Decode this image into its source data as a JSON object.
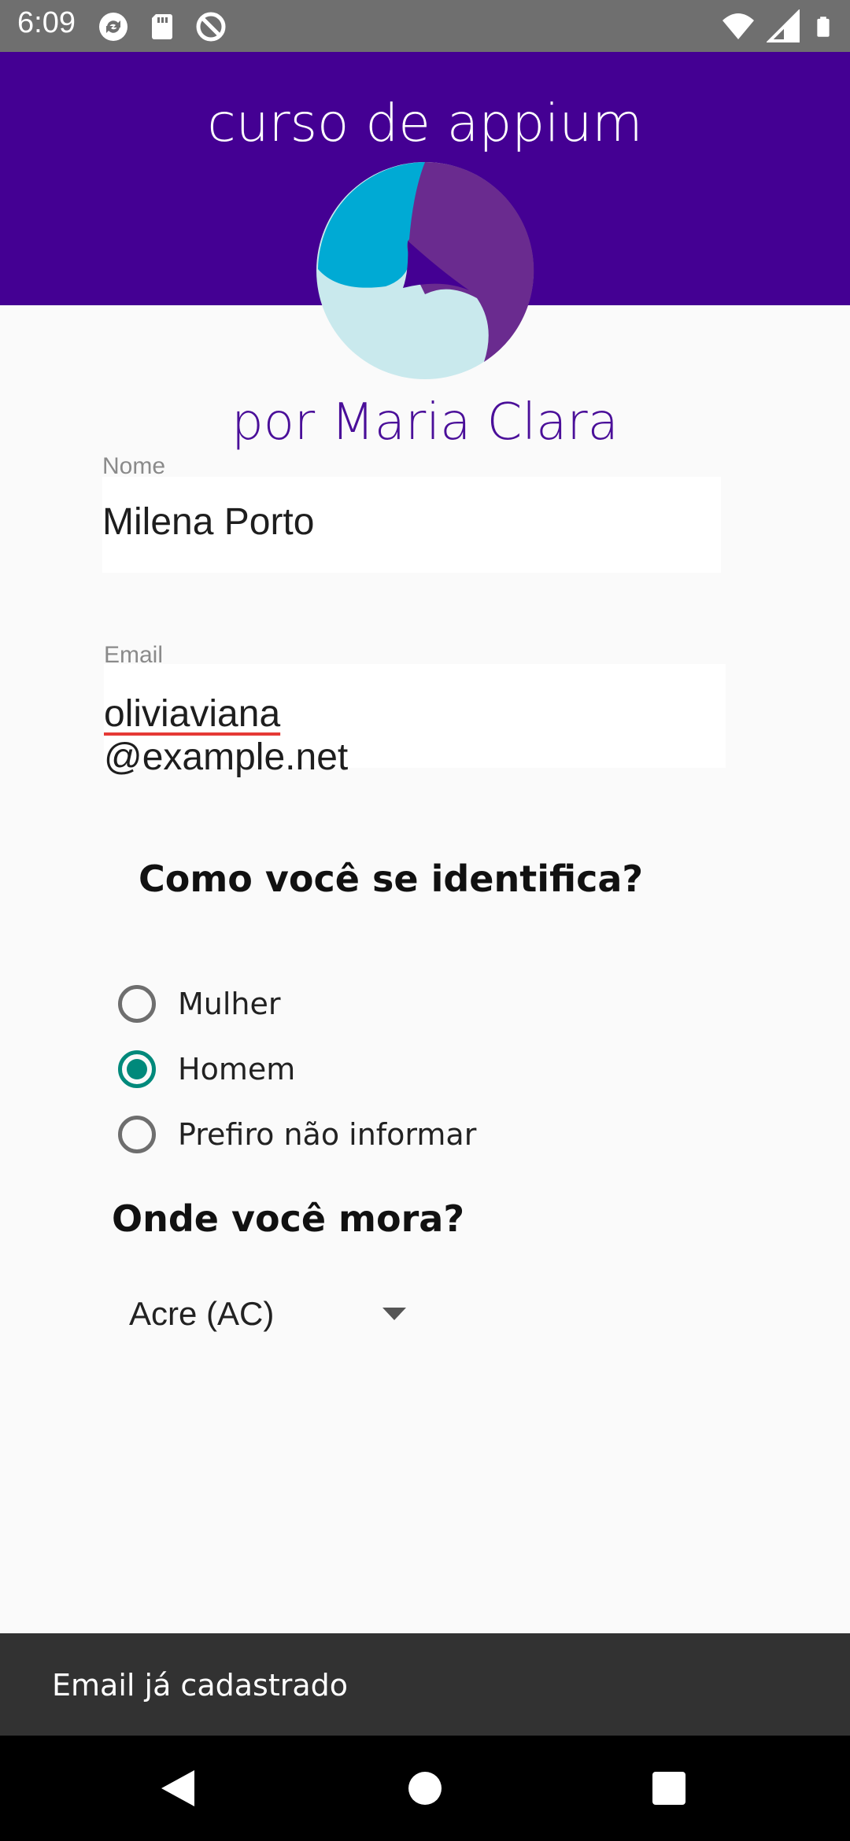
{
  "colors": {
    "header_bg": "#440093",
    "accent": "#00897b",
    "subtitle": "#4a0f99",
    "status_bar": "#6f6f6f",
    "snackbar": "#323232"
  },
  "status_bar": {
    "time": "6:09",
    "left_icons": [
      "sync-icon",
      "sd-card-icon",
      "do-not-disturb-icon"
    ],
    "right_icons": [
      "wifi-icon",
      "signal-icon",
      "battery-icon"
    ]
  },
  "header": {
    "title": "curso de appium",
    "logo": "app-logo"
  },
  "subtitle": "por Maria Clara",
  "form": {
    "name": {
      "label": "Nome",
      "value": "Milena Porto"
    },
    "email": {
      "label": "Email",
      "value_user": "oliviaviana",
      "value_domain": "@example.net"
    },
    "gender": {
      "question": "Como você se identifica?",
      "options": [
        "Mulher",
        "Homem",
        "Prefiro não informar"
      ],
      "selected": "Homem"
    },
    "location": {
      "question": "Onde você mora?",
      "selected": "Acre (AC)",
      "icon": "dropdown-arrow-icon"
    }
  },
  "snackbar": {
    "message": "Email já cadastrado"
  },
  "nav_bar": {
    "icons": [
      "back-icon",
      "home-icon",
      "recents-icon"
    ]
  }
}
